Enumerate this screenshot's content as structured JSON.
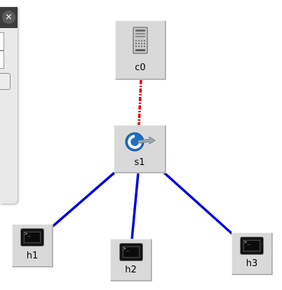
{
  "window": {
    "close_glyph": "×"
  },
  "topology": {
    "controller": {
      "label": "c0",
      "icon": "controller-server-icon"
    },
    "switch": {
      "label": "s1",
      "icon": "openflow-switch-icon"
    },
    "hosts": [
      {
        "label": "h1",
        "icon": "host-terminal-icon"
      },
      {
        "label": "h2",
        "icon": "host-terminal-icon"
      },
      {
        "label": "h3",
        "icon": "host-terminal-icon"
      }
    ],
    "links": [
      {
        "from": "c0",
        "to": "s1",
        "kind": "control",
        "color": "#e00000"
      },
      {
        "from": "s1",
        "to": "h1",
        "kind": "data",
        "color": "#0000e0"
      },
      {
        "from": "s1",
        "to": "h2",
        "kind": "data",
        "color": "#0000e0"
      },
      {
        "from": "s1",
        "to": "h3",
        "kind": "data",
        "color": "#0000e0"
      }
    ]
  },
  "colors": {
    "node_bg": "#d9d9d9",
    "control_link": "#e00000",
    "data_link": "#0000e0"
  }
}
